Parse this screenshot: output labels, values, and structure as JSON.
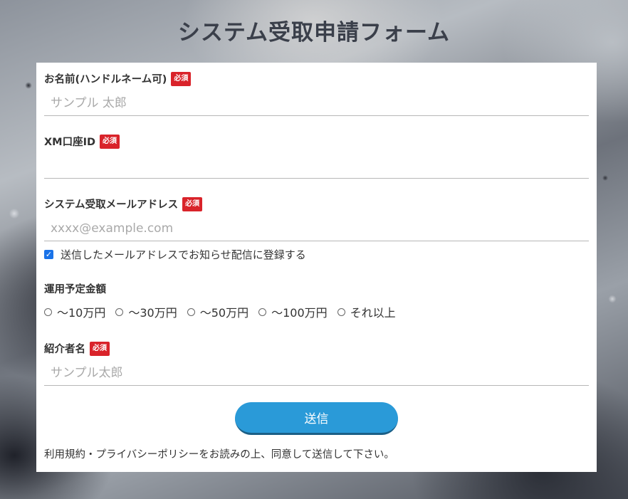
{
  "page": {
    "title": "システム受取申請フォーム"
  },
  "form": {
    "required_badge": "必須",
    "name": {
      "label": "お名前(ハンドルネーム可)",
      "placeholder": "サンプル 太郎",
      "value": ""
    },
    "account_id": {
      "label": "XM口座ID",
      "placeholder": "",
      "value": ""
    },
    "email": {
      "label": "システム受取メールアドレス",
      "placeholder": "xxxx@example.com",
      "value": ""
    },
    "newsletter": {
      "label": "送信したメールアドレスでお知らせ配信に登録する",
      "checked": true
    },
    "amount": {
      "label": "運用予定金額",
      "options": [
        "～10万円",
        "～30万円",
        "～50万円",
        "～100万円",
        "それ以上"
      ]
    },
    "referrer": {
      "label": "紹介者名",
      "placeholder": "サンプル太郎",
      "value": ""
    },
    "submit_label": "送信",
    "notice": "利用規約・プライバシーポリシーをお読みの上、同意して送信して下さい。"
  },
  "colors": {
    "required_badge": "#d9232a",
    "submit_button": "#2a9ad8",
    "checkbox": "#1a73e8"
  }
}
